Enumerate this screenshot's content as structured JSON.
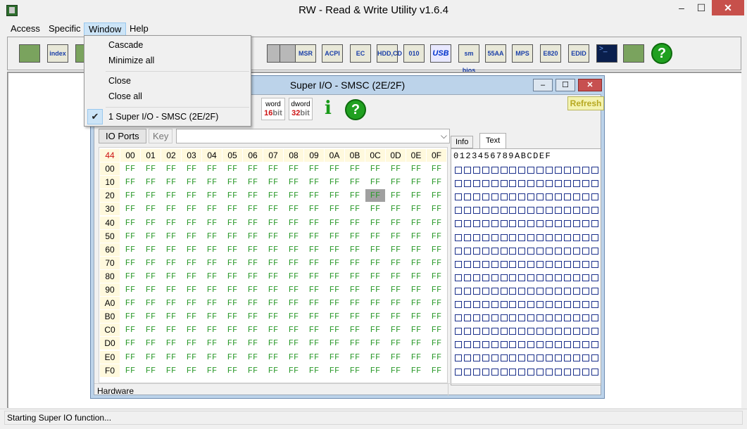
{
  "app": {
    "title": "RW - Read & Write Utility v1.6.4"
  },
  "window_controls": {
    "minimize": "–",
    "maximize": "☐",
    "close": "✕"
  },
  "menubar": {
    "access": "Access",
    "specific": "Specific",
    "window": "Window",
    "help": "Help"
  },
  "window_menu": {
    "cascade": "Cascade",
    "minimize_all": "Minimize all",
    "close": "Close",
    "close_all": "Close all",
    "window_1": "1 Super I/O - SMSC (2E/2F)",
    "checkmark": "✔"
  },
  "toolbar": {
    "labels": [
      "index",
      "MSR",
      "ACPI",
      "EC",
      "HDD,CD",
      "010",
      "USB",
      "sm bios",
      "55AA",
      "MPS",
      "E820",
      "EDID",
      "?"
    ],
    "icons": [
      "pci-icon",
      "index-io-icon",
      "io-space-icon",
      "memory-icon",
      "cmos-icon",
      "msr-icon",
      "acpi-icon",
      "ec-icon",
      "hdd-cd-icon",
      "smbus-icon",
      "usb-icon",
      "smbios-icon",
      "rom-55aa-icon",
      "mps-icon",
      "e820-icon",
      "edid-icon",
      "command-icon",
      "battery-icon",
      "help-icon"
    ]
  },
  "child": {
    "title": "Super I/O - SMSC (2E/2F)",
    "refresh": "Refresh",
    "word_label": "word",
    "word_bits": "16",
    "dword_label": "dword",
    "dword_bits": "32",
    "bit_suffix": "bit",
    "info_glyph": "i",
    "help_glyph": "?",
    "tab_io": "IO Ports",
    "tab_key": "Key",
    "combo_arrow": "⌵",
    "tab_info": "Info",
    "tab_text": "Text",
    "hardware": "Hardware"
  },
  "grid": {
    "corner": "44",
    "col_headers": [
      "00",
      "01",
      "02",
      "03",
      "04",
      "05",
      "06",
      "07",
      "08",
      "09",
      "0A",
      "0B",
      "0C",
      "0D",
      "0E",
      "0F"
    ],
    "row_headers": [
      "00",
      "10",
      "20",
      "30",
      "40",
      "50",
      "60",
      "70",
      "80",
      "90",
      "A0",
      "B0",
      "C0",
      "D0",
      "E0",
      "F0"
    ],
    "value": "FF",
    "selected": {
      "row": 2,
      "col": 12
    }
  },
  "textpane": {
    "header": "0123456789ABCDEF"
  },
  "status": {
    "text": "Starting Super IO function..."
  }
}
